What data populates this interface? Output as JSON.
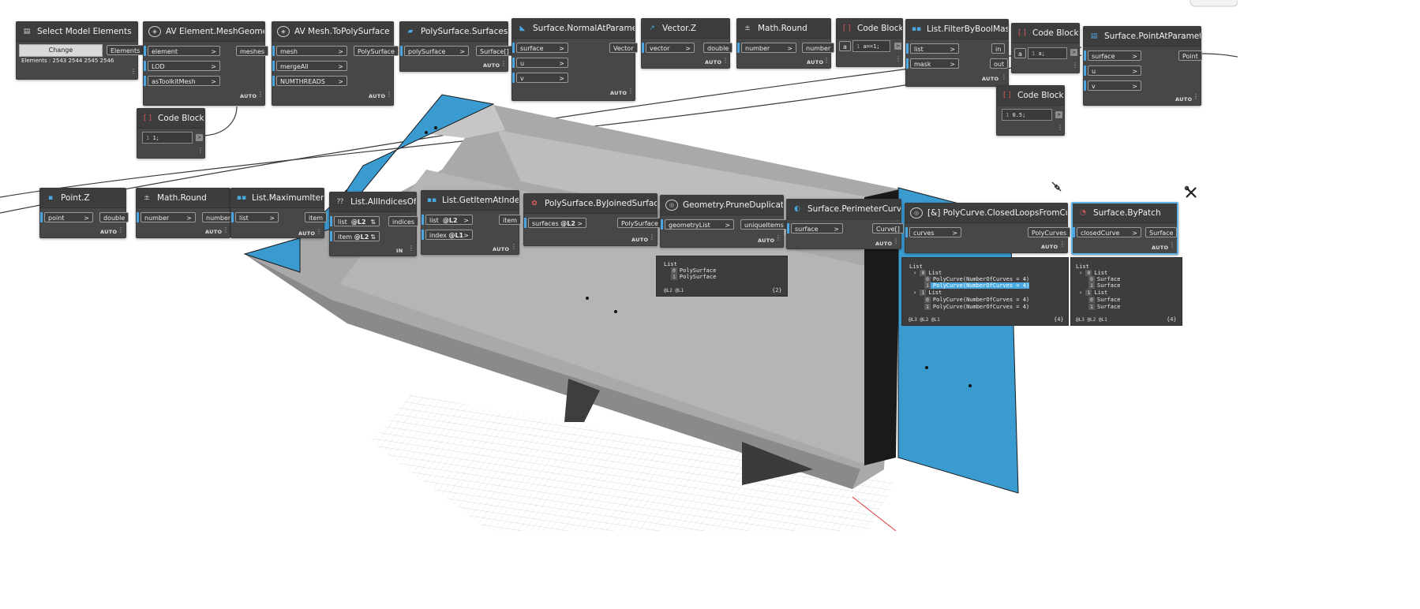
{
  "nodes": {
    "select_model": {
      "title": "Select Model Elements",
      "button": "Change",
      "output": "Elements",
      "info": "Elements : 2543 2544 2545 2546"
    },
    "mesh_geometry": {
      "title": "Element.MeshGeometry",
      "prefix": "AV",
      "inputs": [
        "element",
        "LOD",
        "asToolkitMesh"
      ],
      "output": "meshes",
      "lacing": "AUTO"
    },
    "mesh_to_polysurface": {
      "title": "Mesh.ToPolySurface",
      "prefix": "AV",
      "inputs": [
        "mesh",
        "mergeAll",
        "NUMTHREADS"
      ],
      "output": "PolySurface",
      "lacing": "AUTO"
    },
    "polysurface_surfaces": {
      "title": "PolySurface.Surfaces",
      "inputs": [
        "polySurface"
      ],
      "output": "Surface[]",
      "lacing": "AUTO"
    },
    "normal_at_param": {
      "title": "Surface.NormalAtParameter",
      "inputs": [
        "surface",
        "u",
        "v"
      ],
      "output": "Vector",
      "lacing": "AUTO"
    },
    "vector_z": {
      "title": "Vector.Z",
      "inputs": [
        "vector"
      ],
      "output": "double",
      "lacing": "AUTO"
    },
    "math_round_top": {
      "title": "Math.Round",
      "inputs": [
        "number"
      ],
      "output": "number",
      "lacing": "AUTO"
    },
    "code_block_a": {
      "title": "Code Block",
      "line": "1",
      "port": "a",
      "code": "a==1;"
    },
    "filter_by_bool": {
      "title": "List.FilterByBoolMask",
      "inputs": [
        "list",
        "mask"
      ],
      "outputs": [
        "in",
        "out"
      ],
      "lacing": "AUTO"
    },
    "code_block_a2": {
      "title": "Code Block",
      "line": "1",
      "port": "a",
      "code": "a;"
    },
    "code_block_half": {
      "title": "Code Block",
      "line": "1",
      "code": "0.5;"
    },
    "point_at_param": {
      "title": "Surface.PointAtParameter",
      "inputs": [
        "surface",
        "u",
        "v"
      ],
      "output": "Point",
      "lacing": "AUTO"
    },
    "code_block_one": {
      "title": "Code Block",
      "line": "1",
      "code": "1;"
    },
    "point_z": {
      "title": "Point.Z",
      "inputs": [
        "point"
      ],
      "output": "double",
      "lacing": "AUTO"
    },
    "math_round_bot": {
      "title": "Math.Round",
      "inputs": [
        "number"
      ],
      "output": "number",
      "lacing": "AUTO"
    },
    "maximum_item": {
      "title": "List.MaximumItem",
      "inputs": [
        "list"
      ],
      "output": "item",
      "lacing": "AUTO"
    },
    "all_indices_of": {
      "title": "List.AllIndicesOf",
      "inputs": [
        "list",
        "item"
      ],
      "levels": [
        "@L2",
        "@L2"
      ],
      "output": "indices",
      "lacing": "IN"
    },
    "get_item_at_index": {
      "title": "List.GetItemAtIndex",
      "inputs": [
        "list",
        "index"
      ],
      "levels": [
        "@L2",
        "@L1"
      ],
      "output": "item",
      "lacing": "AUTO"
    },
    "by_joined_surfaces": {
      "title": "PolySurface.ByJoinedSurfaces",
      "inputs": [
        "surfaces"
      ],
      "levels": [
        "@L2"
      ],
      "output": "PolySurface",
      "lacing": "AUTO"
    },
    "prune_duplicates": {
      "title": "Geometry.PruneDuplicates",
      "inputs": [
        "geometryList"
      ],
      "output": "uniqueItems",
      "lacing": "AUTO"
    },
    "perimeter_curves": {
      "title": "Surface.PerimeterCurves",
      "inputs": [
        "surface"
      ],
      "output": "Curve[]",
      "lacing": "AUTO"
    },
    "closed_loops": {
      "title": "[&] PolyCurve.ClosedLoopsFromCurves",
      "inputs": [
        "curves"
      ],
      "output": "PolyCurves",
      "lacing": "AUTO"
    },
    "surface_by_patch": {
      "title": "Surface.ByPatch",
      "inputs": [
        "closedCurve"
      ],
      "output": "Surface",
      "lacing": "AUTO"
    }
  },
  "previews": {
    "prune": {
      "rows": [
        "List",
        "PolySurface",
        "PolySurface"
      ],
      "indices": [
        "0",
        "1"
      ],
      "levels": "@L2 @L1",
      "count": "{2}"
    },
    "loops": {
      "rows": [
        "List",
        "List",
        "PolyCurve(NumberOfCurves = 4)",
        "PolyCurve(NumberOfCurves = 4)",
        "List",
        "PolyCurve(NumberOfCurves = 4)",
        "PolyCurve(NumberOfCurves = 4)"
      ],
      "indices": [
        "0",
        "0",
        "1",
        "1",
        "0",
        "1"
      ],
      "levels": "@L3 @L2 @L1",
      "count": "{4}"
    },
    "patch": {
      "rows": [
        "List",
        "List",
        "Surface",
        "Surface",
        "List",
        "Surface",
        "Surface"
      ],
      "indices": [
        "0",
        "0",
        "1",
        "1",
        "0",
        "1"
      ],
      "levels": "@L3 @L2 @L1",
      "count": "{4}"
    }
  },
  "colors": {
    "node_bg": "#474747",
    "header_bg": "#3d3d3d",
    "accent": "#49a6e0",
    "surface_blue": "#3a9bd1",
    "mass_grey": "#a8a8a8"
  },
  "icons": [
    "pin-icon",
    "wrench-icon"
  ]
}
